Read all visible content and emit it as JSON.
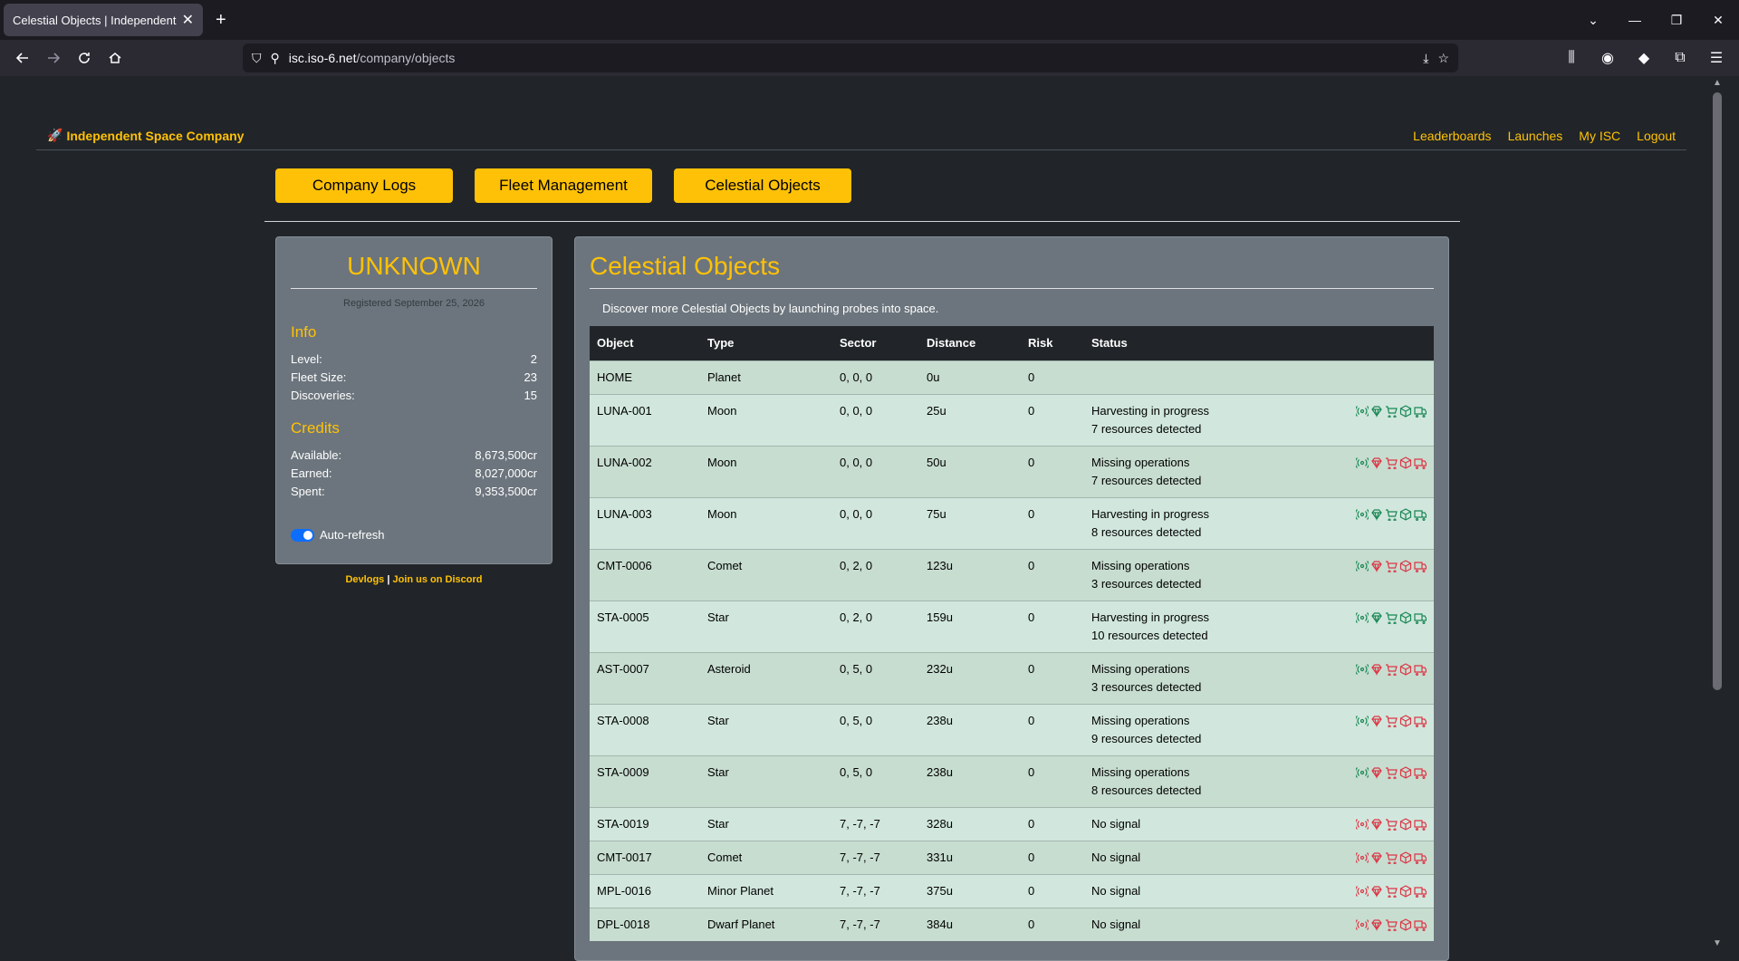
{
  "browser": {
    "tab_title": "Celestial Objects | Independent Space",
    "url_domain": "isc.iso-6.net",
    "url_path": "/company/objects"
  },
  "header": {
    "brand": "Independent Space Company",
    "nav": [
      "Leaderboards",
      "Launches",
      "My ISC",
      "Logout"
    ]
  },
  "tabs": [
    "Company Logs",
    "Fleet Management",
    "Celestial Objects"
  ],
  "profile": {
    "name": "UNKNOWN",
    "registered": "Registered September 25, 2026",
    "info_title": "Info",
    "info": [
      {
        "label": "Level:",
        "value": "2"
      },
      {
        "label": "Fleet Size:",
        "value": "23"
      },
      {
        "label": "Discoveries:",
        "value": "15"
      }
    ],
    "credits_title": "Credits",
    "credits": [
      {
        "label": "Available:",
        "value": "8,673,500cr"
      },
      {
        "label": "Earned:",
        "value": "8,027,000cr"
      },
      {
        "label": "Spent:",
        "value": "9,353,500cr"
      }
    ],
    "auto_refresh": "Auto-refresh",
    "devlogs": "Devlogs",
    "separator": "|",
    "discord": "Join us on Discord"
  },
  "main": {
    "title": "Celestial Objects",
    "intro": "Discover more Celestial Objects by launching probes into space.",
    "columns": [
      "Object",
      "Type",
      "Sector",
      "Distance",
      "Risk",
      "Status"
    ],
    "rows": [
      {
        "object": "HOME",
        "type": "Planet",
        "sector": "0, 0, 0",
        "distance": "0u",
        "risk": "0",
        "status": "",
        "status2": "",
        "icons": "none"
      },
      {
        "object": "LUNA-001",
        "type": "Moon",
        "sector": "0, 0, 0",
        "distance": "25u",
        "risk": "0",
        "status": "Harvesting in progress",
        "status2": "7 resources detected",
        "icons": "green"
      },
      {
        "object": "LUNA-002",
        "type": "Moon",
        "sector": "0, 0, 0",
        "distance": "50u",
        "risk": "0",
        "status": "Missing operations",
        "status2": "7 resources detected",
        "icons": "mixed"
      },
      {
        "object": "LUNA-003",
        "type": "Moon",
        "sector": "0, 0, 0",
        "distance": "75u",
        "risk": "0",
        "status": "Harvesting in progress",
        "status2": "8 resources detected",
        "icons": "green"
      },
      {
        "object": "CMT-0006",
        "type": "Comet",
        "sector": "0, 2, 0",
        "distance": "123u",
        "risk": "0",
        "status": "Missing operations",
        "status2": "3 resources detected",
        "icons": "mixed"
      },
      {
        "object": "STA-0005",
        "type": "Star",
        "sector": "0, 2, 0",
        "distance": "159u",
        "risk": "0",
        "status": "Harvesting in progress",
        "status2": "10 resources detected",
        "icons": "green"
      },
      {
        "object": "AST-0007",
        "type": "Asteroid",
        "sector": "0, 5, 0",
        "distance": "232u",
        "risk": "0",
        "status": "Missing operations",
        "status2": "3 resources detected",
        "icons": "mixed"
      },
      {
        "object": "STA-0008",
        "type": "Star",
        "sector": "0, 5, 0",
        "distance": "238u",
        "risk": "0",
        "status": "Missing operations",
        "status2": "9 resources detected",
        "icons": "mixed"
      },
      {
        "object": "STA-0009",
        "type": "Star",
        "sector": "0, 5, 0",
        "distance": "238u",
        "risk": "0",
        "status": "Missing operations",
        "status2": "8 resources detected",
        "icons": "mixed"
      },
      {
        "object": "STA-0019",
        "type": "Star",
        "sector": "7, -7, -7",
        "distance": "328u",
        "risk": "0",
        "status": "No signal",
        "status2": "",
        "icons": "red"
      },
      {
        "object": "CMT-0017",
        "type": "Comet",
        "sector": "7, -7, -7",
        "distance": "331u",
        "risk": "0",
        "status": "No signal",
        "status2": "",
        "icons": "red"
      },
      {
        "object": "MPL-0016",
        "type": "Minor Planet",
        "sector": "7, -7, -7",
        "distance": "375u",
        "risk": "0",
        "status": "No signal",
        "status2": "",
        "icons": "red"
      },
      {
        "object": "DPL-0018",
        "type": "Dwarf Planet",
        "sector": "7, -7, -7",
        "distance": "384u",
        "risk": "0",
        "status": "No signal",
        "status2": "",
        "icons": "red"
      }
    ]
  },
  "colors": {
    "accent": "#ffc107",
    "ok": "#198754",
    "bad": "#dc3545"
  },
  "icon_names": [
    "signal-icon",
    "gem-icon",
    "cart-icon",
    "box-icon",
    "truck-icon"
  ]
}
